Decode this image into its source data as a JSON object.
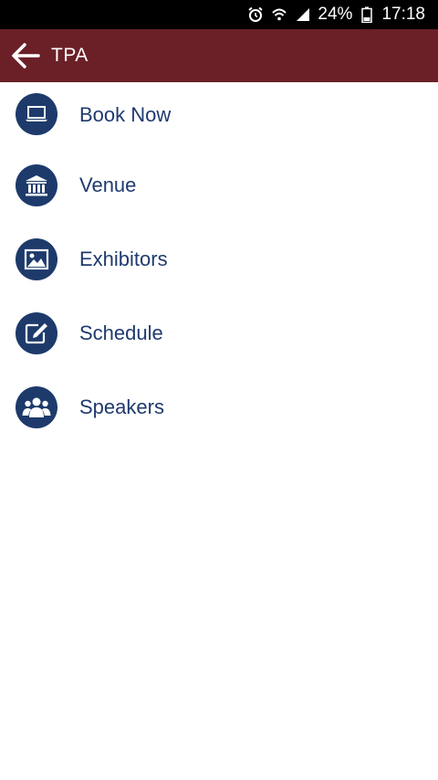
{
  "status_bar": {
    "battery": "24%",
    "time": "17:18",
    "icons": [
      "alarm-icon",
      "wifi-icon",
      "signal-icon",
      "battery-icon"
    ]
  },
  "app_bar": {
    "title": "TPA",
    "back_icon": "arrow-left-icon",
    "color": "#6b2027"
  },
  "menu": {
    "icon_color": "#1d3a6b",
    "items": [
      {
        "label": "Book Now",
        "icon": "laptop-icon"
      },
      {
        "label": "Venue",
        "icon": "building-icon"
      },
      {
        "label": "Exhibitors",
        "icon": "image-icon"
      },
      {
        "label": "Schedule",
        "icon": "edit-icon"
      },
      {
        "label": "Speakers",
        "icon": "people-icon"
      }
    ]
  }
}
